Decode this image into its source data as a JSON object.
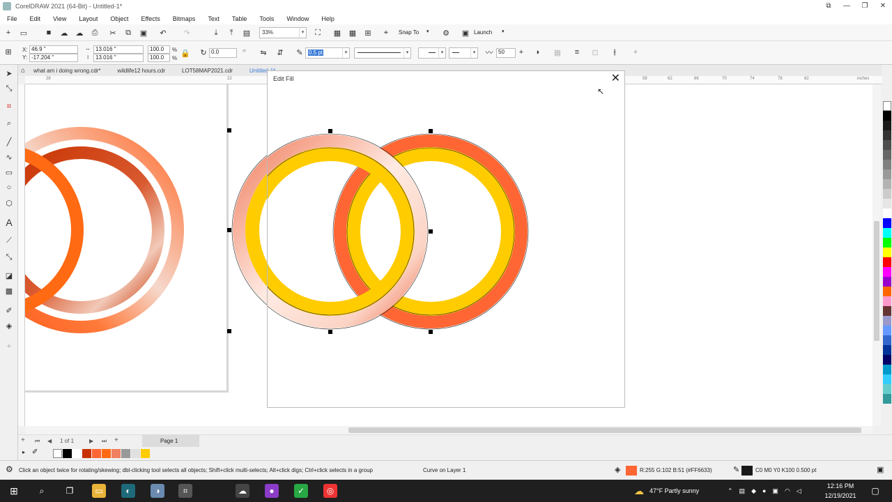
{
  "window": {
    "title": "CorelDRAW 2021 (64-Bit) - Untitled-1*",
    "controls": [
      "⧉",
      "—",
      "❐",
      "✕"
    ]
  },
  "menu": [
    "File",
    "Edit",
    "View",
    "Layout",
    "Object",
    "Effects",
    "Bitmaps",
    "Text",
    "Table",
    "Tools",
    "Window",
    "Help"
  ],
  "toolbar": {
    "zoom_value": "33%",
    "snap_to_label": "Snap To",
    "launch_label": "Launch"
  },
  "propbar": {
    "x_label": "X:",
    "x_value": "46.9 \"",
    "y_label": "Y:",
    "y_value": "-17.204 \"",
    "width_value": "13.016 \"",
    "height_value": "13.016 \"",
    "scale_w": "100.0",
    "scale_h": "100.0",
    "percent": "%",
    "rotation_value": "0.0",
    "outline_width": "0.5 pt",
    "smoothing_value": "50"
  },
  "doc_tabs": [
    "what am i doing wrong.cdr*",
    "wildlife12 hours.cdr",
    "LOT58MAP2021.cdr",
    "Untitled-1*"
  ],
  "ruler": {
    "top_ticks": [
      "28",
      "22",
      "58",
      "62",
      "66",
      "70",
      "74",
      "78",
      "82"
    ],
    "unit": "inches"
  },
  "edit_fill": {
    "title": "Edit Fill",
    "close_glyph": "✕"
  },
  "palette_colors": [
    "#ffffff",
    "#000000",
    "#1a1a1a",
    "#333333",
    "#4d4d4d",
    "#666666",
    "#808080",
    "#999999",
    "#b3b3b3",
    "#cccccc",
    "#e6e6e6",
    "#ffffff",
    "#0000ff",
    "#00ffff",
    "#00ff00",
    "#ffff00",
    "#ff0000",
    "#ff00ff",
    "#9900cc",
    "#ff6600",
    "#ff99cc",
    "#663333",
    "#9999cc",
    "#6699ff",
    "#3366cc",
    "#003399",
    "#000066",
    "#0099cc",
    "#33ccff",
    "#66cccc",
    "#339999"
  ],
  "page_nav": {
    "count_text": "1 of 1",
    "page_tab": "Page 1"
  },
  "doc_palette": [
    "#000000",
    "#ffffff",
    "#c83200",
    "#ff6633",
    "#ff6a13",
    "#f08060",
    "#999999",
    "#e0e0e0",
    "#ffcc00"
  ],
  "status": {
    "hint": "Click an object twice for rotating/skewing; dbl-clicking tool selects all objects; Shift+click multi-selects; Alt+click digs; Ctrl+click selects in a group",
    "object_info": "Curve on Layer 1",
    "fill_color": "#ff6633",
    "fill_text": "R:255 G:102 B:51 (#FF6633)",
    "outline_color": "#1a1a1a",
    "outline_text": "C0 M0 Y0 K100  0.500 pt"
  },
  "taskbar": {
    "weather": "47°F  Partly sunny",
    "time": "12:16 PM",
    "date": "12/19/2021"
  }
}
